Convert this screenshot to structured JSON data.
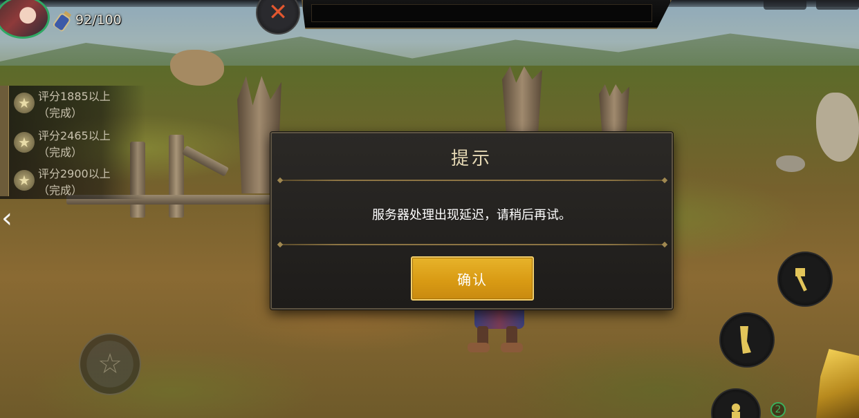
{
  "hud": {
    "stamina_current": "92",
    "stamina_separator": "/",
    "stamina_max": "100"
  },
  "quests": [
    {
      "requirement": "评分1885以上",
      "status": "（完成）"
    },
    {
      "requirement": "评分2465以上",
      "status": "（完成）"
    },
    {
      "requirement": "评分2900以上",
      "status": "（完成）"
    }
  ],
  "dialog": {
    "title": "提示",
    "message": "服务器处理出现延迟，请稍后再试。",
    "confirm_label": "确认"
  },
  "skill_badge": "2",
  "colors": {
    "accent_gold": "#d99b14",
    "dialog_bg": "#2b2926",
    "dialog_title": "#e6d9b5",
    "avatar_ring": "#2fa864"
  },
  "icons": {
    "skill_orb": "crossed-swords-icon",
    "stamina": "potion-icon",
    "quest": "star-icon",
    "back": "chevron-left-icon",
    "joystick": "pentagram-icon"
  }
}
